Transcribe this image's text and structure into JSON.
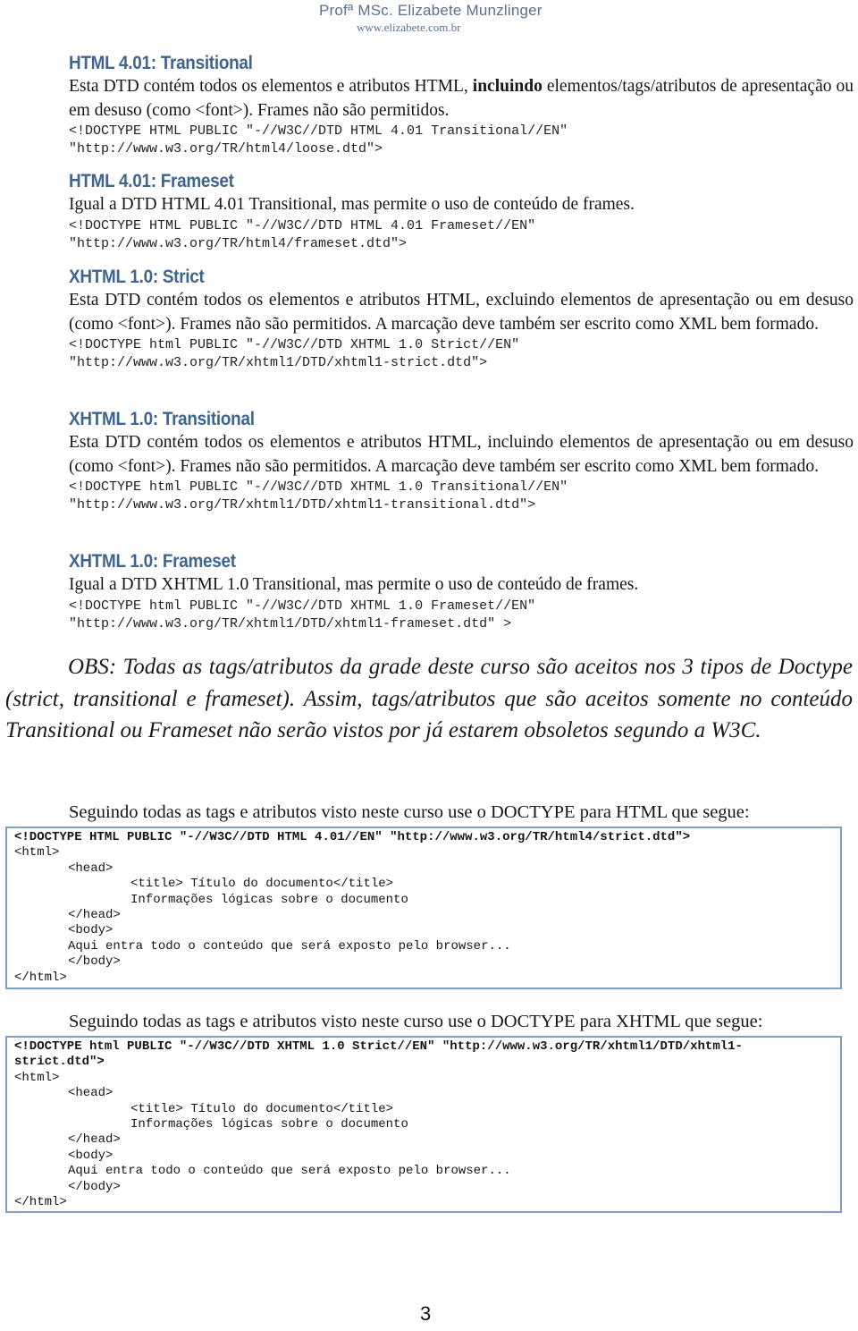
{
  "header": {
    "author": "Profª MSc. Elizabete Munzlinger",
    "website": "www.elizabete.com.br"
  },
  "sections": [
    {
      "title": "HTML 4.01: Transitional",
      "text_before_bold": "Esta DTD contém todos os elementos e atributos HTML, ",
      "text_bold": "incluindo",
      "text_after_bold": " elementos/tags/atributos de apresentação ou em desuso (como <font>). Frames não são permitidos.",
      "code_lines": [
        "<!DOCTYPE HTML PUBLIC \"-//W3C//DTD HTML 4.01 Transitional//EN\"",
        "\"http://www.w3.org/TR/html4/loose.dtd\">"
      ]
    },
    {
      "title": "HTML 4.01: Frameset",
      "text": "Igual a DTD HTML 4.01 Transitional, mas permite o uso de conteúdo de frames.",
      "code_lines": [
        "<!DOCTYPE HTML PUBLIC \"-//W3C//DTD HTML 4.01 Frameset//EN\"",
        "\"http://www.w3.org/TR/html4/frameset.dtd\">"
      ]
    },
    {
      "title": "XHTML 1.0: Strict",
      "text": "Esta DTD contém todos os elementos e atributos HTML, excluindo elementos de apresentação ou em desuso (como <font>). Frames não são permitidos. A marcação deve também ser escrito como XML bem formado.",
      "code_lines": [
        "<!DOCTYPE html PUBLIC \"-//W3C//DTD XHTML 1.0 Strict//EN\"",
        "\"http://www.w3.org/TR/xhtml1/DTD/xhtml1-strict.dtd\">"
      ]
    },
    {
      "title": "XHTML 1.0: Transitional",
      "text": "Esta DTD contém todos os elementos e atributos HTML, incluindo elementos de apresentação ou em desuso (como <font>). Frames não são permitidos. A marcação deve também ser escrito como XML bem formado.",
      "code_lines": [
        "<!DOCTYPE html PUBLIC \"-//W3C//DTD XHTML 1.0 Transitional//EN\"",
        "\"http://www.w3.org/TR/xhtml1/DTD/xhtml1-transitional.dtd\">"
      ]
    },
    {
      "title": "XHTML 1.0: Frameset",
      "text": "Igual a DTD XHTML 1.0 Transitional, mas permite o uso de conteúdo de frames.",
      "code_lines": [
        "<!DOCTYPE html PUBLIC \"-//W3C//DTD XHTML 1.0 Frameset//EN\"",
        "\"http://www.w3.org/TR/xhtml1/DTD/xhtml1-frameset.dtd\" >"
      ]
    }
  ],
  "obs": "OBS: Todas as tags/atributos da grade deste curso são aceitos nos 3 tipos de Doctype (strict, transitional e frameset). Assim, tags/atributos que são aceitos somente no conteúdo Transitional ou Frameset não serão vistos por já estarem obsoletos segundo a W3C.",
  "html_example": {
    "intro": "Seguindo todas as tags e atributos visto neste curso use o DOCTYPE para HTML que segue:",
    "doctype": "<!DOCTYPE HTML PUBLIC \"-//W3C//DTD HTML 4.01//EN\" \"http://www.w3.org/TR/html4/strict.dtd\">",
    "html_open": "<html>",
    "head_open": "<head>",
    "title_line": "<title> Título do documento</title>",
    "info_line": "Informações lógicas sobre o documento",
    "head_close": "</head>",
    "body_open": "<body>",
    "body_content": "Aqui entra todo o conteúdo que será exposto pelo browser...",
    "body_close": "</body>",
    "html_close": "</html>"
  },
  "xhtml_example": {
    "intro": "Seguindo todas as tags e atributos visto neste curso use o DOCTYPE para XHTML que segue:",
    "doctype_line1": "<!DOCTYPE html PUBLIC \"-//W3C//DTD XHTML 1.0 Strict//EN\" \"http://www.w3.org/TR/xhtml1/DTD/xhtml1-",
    "doctype_line2": "strict.dtd\">",
    "html_open": "<html>",
    "head_open": "<head>",
    "title_line": "<title> Título do documento</title>",
    "info_line": "Informações lógicas sobre o documento",
    "head_close": "</head>",
    "body_open": "<body>",
    "body_content": "Aqui entra todo o conteúdo que será exposto pelo browser...",
    "body_close": "</body>",
    "html_close": "</html>"
  },
  "page_number": "3"
}
